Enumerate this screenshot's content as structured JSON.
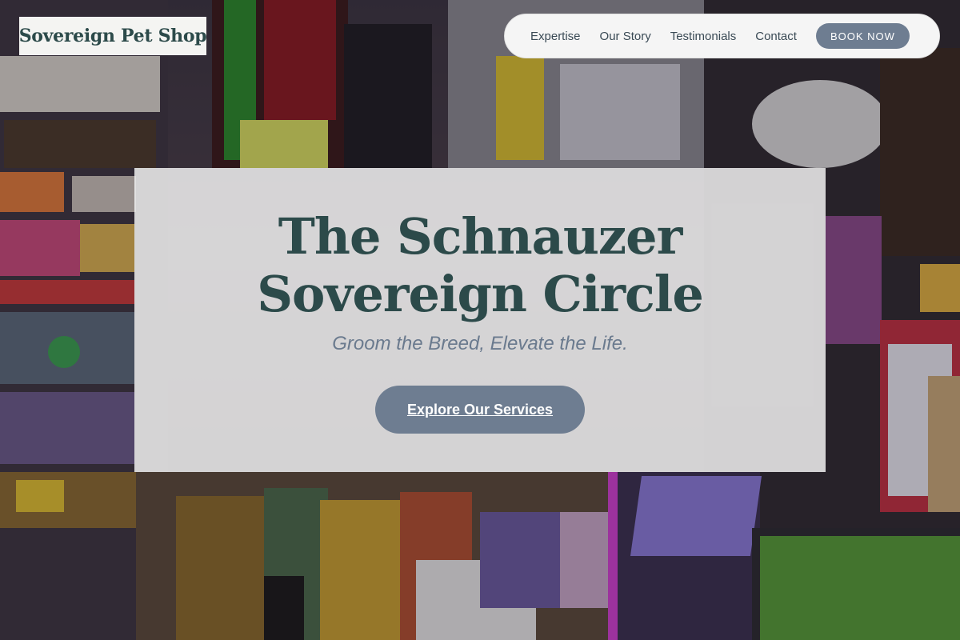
{
  "brand": {
    "name": "Sovereign Pet Shop"
  },
  "nav": {
    "links": [
      "Expertise",
      "Our Story",
      "Testimonials",
      "Contact"
    ],
    "book_label": "BOOK NOW"
  },
  "hero": {
    "title_line1": "The Schnauzer",
    "title_line2": "Sovereign Circle",
    "tagline": "Groom the Breed, Elevate the Life.",
    "cta_label": "Explore Our Services"
  },
  "colors": {
    "heading": "#2c4a4a",
    "accent_button": "#6e7d91",
    "tagline": "#6a7a8e",
    "panel": "#f0f0f0"
  }
}
